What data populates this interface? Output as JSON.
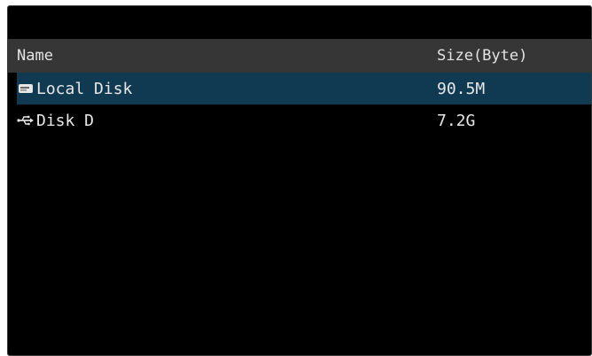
{
  "file_list": {
    "columns": {
      "name": "Name",
      "size": "Size(Byte)"
    },
    "rows": [
      {
        "icon": "hard-disk-icon",
        "name": "Local Disk",
        "size": "90.5M",
        "selected": true
      },
      {
        "icon": "usb-icon",
        "name": "Disk D",
        "size": "7.2G",
        "selected": false
      }
    ]
  },
  "colors": {
    "background": "#000000",
    "header_background": "#363636",
    "selected_row": "#0f3a52",
    "text": "#e8e8e8"
  }
}
